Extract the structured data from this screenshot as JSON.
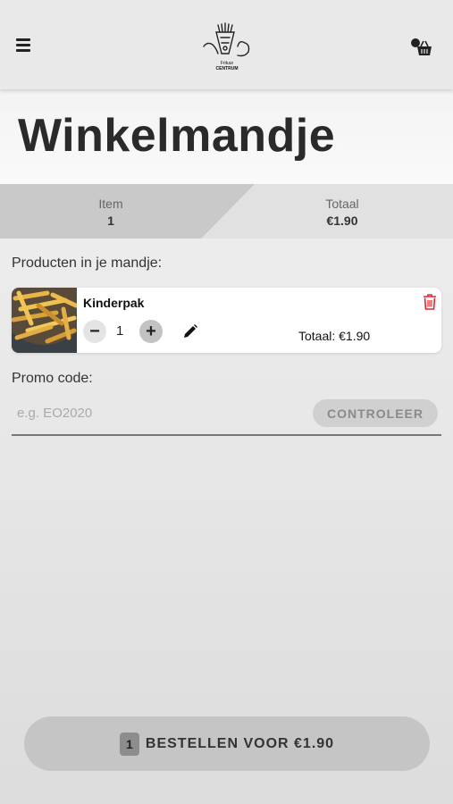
{
  "header": {
    "logo_text_top": "Frituur",
    "logo_text_bottom": "CENTRUM"
  },
  "page": {
    "title": "Winkelmandje"
  },
  "summary": {
    "item_label": "Item",
    "item_value": "1",
    "total_label": "Totaal",
    "total_value": "€1.90"
  },
  "cart": {
    "section_label": "Producten in je mandje:",
    "items": [
      {
        "name": "Kinderpak",
        "quantity": "1",
        "line_total": "Totaal: €1.90"
      }
    ]
  },
  "promo": {
    "label": "Promo code:",
    "placeholder": "e.g. EO2020",
    "value": "",
    "check_label": "CONTROLEER"
  },
  "order": {
    "count": "1",
    "label": "BESTELLEN VOOR €1.90"
  },
  "colors": {
    "delete": "#e0262f",
    "button_bg": "#c5c5c5",
    "summary_active": "#c9c9c9"
  }
}
